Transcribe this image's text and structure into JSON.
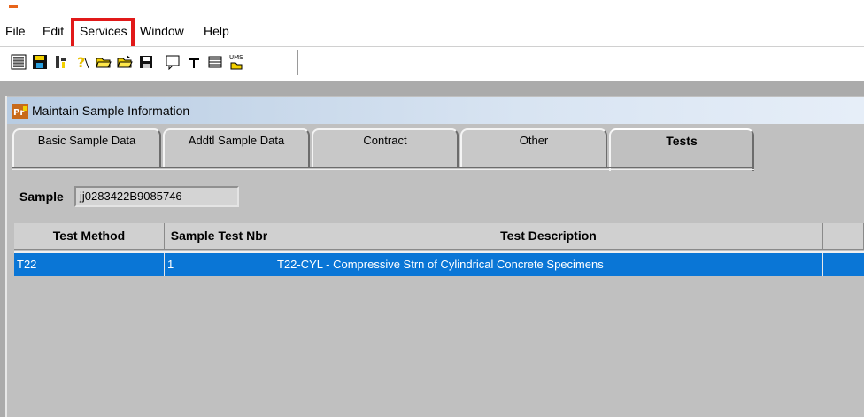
{
  "menubar": {
    "items": [
      "File",
      "Edit",
      "Services",
      "Window",
      "Help"
    ],
    "highlighted": "Services"
  },
  "toolbar": {
    "buttons": [
      "list-icon",
      "save-disk-icon",
      "tools-icon",
      "help-icon",
      "open-folder-icon",
      "open-folder-alt-icon",
      "floppy-icon",
      "comment-icon",
      "text-tool-icon",
      "grid-icon",
      "ums-icon"
    ]
  },
  "window": {
    "title": "Maintain Sample Information",
    "icon_text": "Pr"
  },
  "tabs": [
    "Basic Sample Data",
    "Addtl Sample Data",
    "Contract",
    "Other",
    "Tests"
  ],
  "active_tab": "Tests",
  "sample": {
    "label": "Sample",
    "value": "jj0283422B9085746"
  },
  "grid": {
    "columns": [
      "Test Method",
      "Sample Test Nbr",
      "Test Description"
    ],
    "rows": [
      [
        "T22",
        "1",
        "T22-CYL - Compressive Strn of Cylindrical Concrete Specimens"
      ]
    ]
  },
  "colors": {
    "selection": "#0a76d6",
    "highlight_box": "#e11919",
    "panel": "#c0c0c0"
  }
}
